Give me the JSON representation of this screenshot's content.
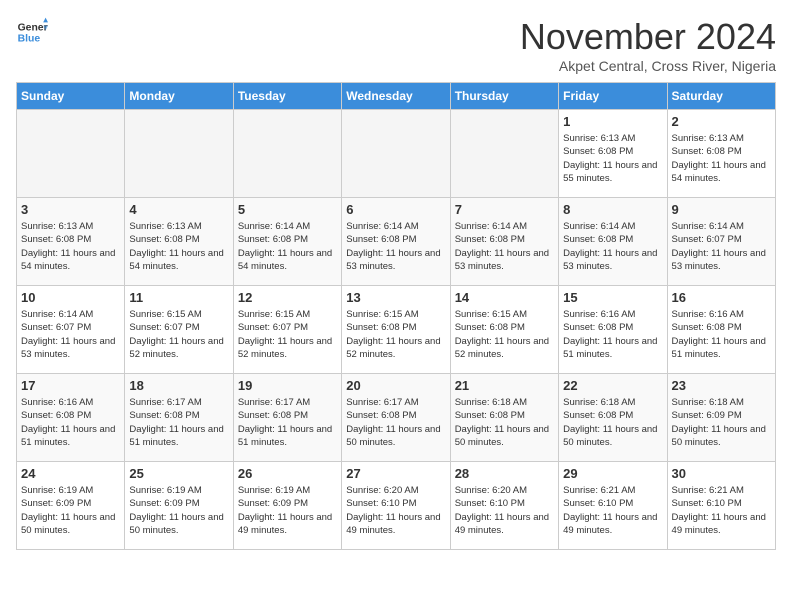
{
  "header": {
    "logo_line1": "General",
    "logo_line2": "Blue",
    "month": "November 2024",
    "location": "Akpet Central, Cross River, Nigeria"
  },
  "weekdays": [
    "Sunday",
    "Monday",
    "Tuesday",
    "Wednesday",
    "Thursday",
    "Friday",
    "Saturday"
  ],
  "weeks": [
    [
      {
        "day": "",
        "info": ""
      },
      {
        "day": "",
        "info": ""
      },
      {
        "day": "",
        "info": ""
      },
      {
        "day": "",
        "info": ""
      },
      {
        "day": "",
        "info": ""
      },
      {
        "day": "1",
        "info": "Sunrise: 6:13 AM\nSunset: 6:08 PM\nDaylight: 11 hours and 55 minutes."
      },
      {
        "day": "2",
        "info": "Sunrise: 6:13 AM\nSunset: 6:08 PM\nDaylight: 11 hours and 54 minutes."
      }
    ],
    [
      {
        "day": "3",
        "info": "Sunrise: 6:13 AM\nSunset: 6:08 PM\nDaylight: 11 hours and 54 minutes."
      },
      {
        "day": "4",
        "info": "Sunrise: 6:13 AM\nSunset: 6:08 PM\nDaylight: 11 hours and 54 minutes."
      },
      {
        "day": "5",
        "info": "Sunrise: 6:14 AM\nSunset: 6:08 PM\nDaylight: 11 hours and 54 minutes."
      },
      {
        "day": "6",
        "info": "Sunrise: 6:14 AM\nSunset: 6:08 PM\nDaylight: 11 hours and 53 minutes."
      },
      {
        "day": "7",
        "info": "Sunrise: 6:14 AM\nSunset: 6:08 PM\nDaylight: 11 hours and 53 minutes."
      },
      {
        "day": "8",
        "info": "Sunrise: 6:14 AM\nSunset: 6:08 PM\nDaylight: 11 hours and 53 minutes."
      },
      {
        "day": "9",
        "info": "Sunrise: 6:14 AM\nSunset: 6:07 PM\nDaylight: 11 hours and 53 minutes."
      }
    ],
    [
      {
        "day": "10",
        "info": "Sunrise: 6:14 AM\nSunset: 6:07 PM\nDaylight: 11 hours and 53 minutes."
      },
      {
        "day": "11",
        "info": "Sunrise: 6:15 AM\nSunset: 6:07 PM\nDaylight: 11 hours and 52 minutes."
      },
      {
        "day": "12",
        "info": "Sunrise: 6:15 AM\nSunset: 6:07 PM\nDaylight: 11 hours and 52 minutes."
      },
      {
        "day": "13",
        "info": "Sunrise: 6:15 AM\nSunset: 6:08 PM\nDaylight: 11 hours and 52 minutes."
      },
      {
        "day": "14",
        "info": "Sunrise: 6:15 AM\nSunset: 6:08 PM\nDaylight: 11 hours and 52 minutes."
      },
      {
        "day": "15",
        "info": "Sunrise: 6:16 AM\nSunset: 6:08 PM\nDaylight: 11 hours and 51 minutes."
      },
      {
        "day": "16",
        "info": "Sunrise: 6:16 AM\nSunset: 6:08 PM\nDaylight: 11 hours and 51 minutes."
      }
    ],
    [
      {
        "day": "17",
        "info": "Sunrise: 6:16 AM\nSunset: 6:08 PM\nDaylight: 11 hours and 51 minutes."
      },
      {
        "day": "18",
        "info": "Sunrise: 6:17 AM\nSunset: 6:08 PM\nDaylight: 11 hours and 51 minutes."
      },
      {
        "day": "19",
        "info": "Sunrise: 6:17 AM\nSunset: 6:08 PM\nDaylight: 11 hours and 51 minutes."
      },
      {
        "day": "20",
        "info": "Sunrise: 6:17 AM\nSunset: 6:08 PM\nDaylight: 11 hours and 50 minutes."
      },
      {
        "day": "21",
        "info": "Sunrise: 6:18 AM\nSunset: 6:08 PM\nDaylight: 11 hours and 50 minutes."
      },
      {
        "day": "22",
        "info": "Sunrise: 6:18 AM\nSunset: 6:08 PM\nDaylight: 11 hours and 50 minutes."
      },
      {
        "day": "23",
        "info": "Sunrise: 6:18 AM\nSunset: 6:09 PM\nDaylight: 11 hours and 50 minutes."
      }
    ],
    [
      {
        "day": "24",
        "info": "Sunrise: 6:19 AM\nSunset: 6:09 PM\nDaylight: 11 hours and 50 minutes."
      },
      {
        "day": "25",
        "info": "Sunrise: 6:19 AM\nSunset: 6:09 PM\nDaylight: 11 hours and 50 minutes."
      },
      {
        "day": "26",
        "info": "Sunrise: 6:19 AM\nSunset: 6:09 PM\nDaylight: 11 hours and 49 minutes."
      },
      {
        "day": "27",
        "info": "Sunrise: 6:20 AM\nSunset: 6:10 PM\nDaylight: 11 hours and 49 minutes."
      },
      {
        "day": "28",
        "info": "Sunrise: 6:20 AM\nSunset: 6:10 PM\nDaylight: 11 hours and 49 minutes."
      },
      {
        "day": "29",
        "info": "Sunrise: 6:21 AM\nSunset: 6:10 PM\nDaylight: 11 hours and 49 minutes."
      },
      {
        "day": "30",
        "info": "Sunrise: 6:21 AM\nSunset: 6:10 PM\nDaylight: 11 hours and 49 minutes."
      }
    ]
  ]
}
